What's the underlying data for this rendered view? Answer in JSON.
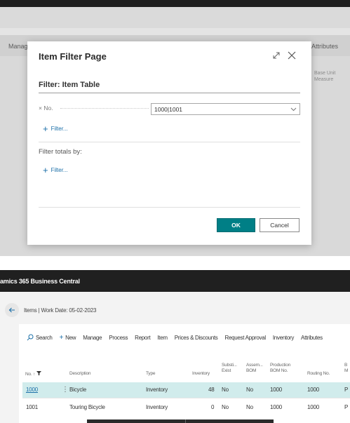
{
  "background_page": {
    "manage_label": "Manag",
    "attributes_label": "Attributes",
    "base_unit_label": "Base Unit Measure"
  },
  "modal": {
    "title": "Item Filter Page",
    "filter_section_title": "Filter: Item Table",
    "filter_field_label": "× No.",
    "filter_field_value": "1000|1001",
    "add_filter_label": "Filter...",
    "totals_label": "Filter totals by:",
    "add_totals_filter_label": "Filter...",
    "ok_label": "OK",
    "cancel_label": "Cancel"
  },
  "app": {
    "title": "amics 365 Business Central",
    "breadcrumb": "Items | Work Date: 05-02-2023"
  },
  "actions": [
    {
      "label": "Search",
      "icon": "search-icon"
    },
    {
      "label": "New",
      "icon": "plus-icon"
    },
    {
      "label": "Manage"
    },
    {
      "label": "Process"
    },
    {
      "label": "Report"
    },
    {
      "label": "Item"
    },
    {
      "label": "Prices & Discounts"
    },
    {
      "label": "Request Approval"
    },
    {
      "label": "Inventory"
    },
    {
      "label": "Attributes"
    }
  ],
  "table": {
    "columns": {
      "no": "No. ↑",
      "description": "Description",
      "type": "Type",
      "inventory": "Inventory",
      "subst_1": "Substi...",
      "subst_2": "Exist",
      "assem_1": "Assem...",
      "assem_2": "BOM",
      "prod_1": "Production",
      "prod_2": "BOM No.",
      "routing": "Routing No.",
      "base_1": "B",
      "base_2": "M"
    },
    "rows": [
      {
        "no": "1000",
        "description": "Bicycle",
        "type": "Inventory",
        "inventory": "48",
        "subst": "No",
        "assem": "No",
        "prod_bom": "1000",
        "routing": "1000",
        "base": "P"
      },
      {
        "no": "1001",
        "description": "Touring Bicycle",
        "type": "Inventory",
        "inventory": "0",
        "subst": "No",
        "assem": "No",
        "prod_bom": "1000",
        "routing": "1000",
        "base": "P"
      }
    ]
  }
}
